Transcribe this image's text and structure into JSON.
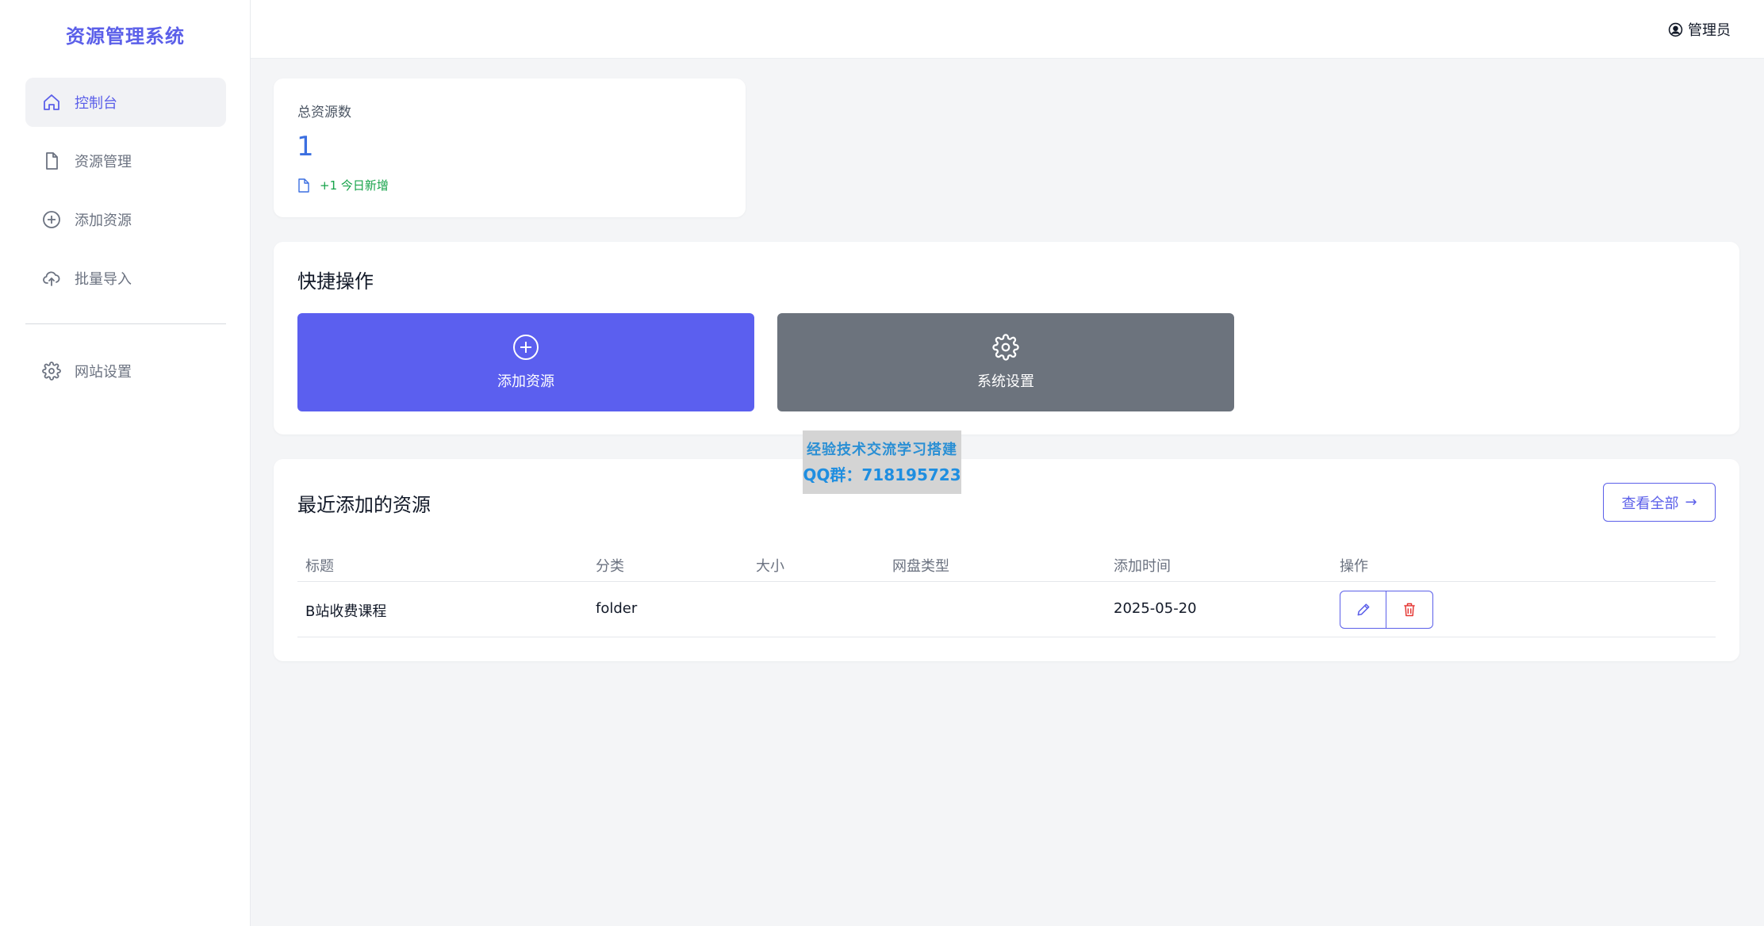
{
  "sidebar": {
    "brand": "资源管理系统",
    "items": [
      {
        "label": "控制台",
        "icon": "home-icon",
        "active": true
      },
      {
        "label": "资源管理",
        "icon": "file-icon"
      },
      {
        "label": "添加资源",
        "icon": "plus-circle-icon"
      },
      {
        "label": "批量导入",
        "icon": "cloud-upload-icon"
      }
    ],
    "settings": {
      "label": "网站设置",
      "icon": "gear-icon"
    }
  },
  "header": {
    "user_label": "管理员",
    "user_icon": "user-circle-icon"
  },
  "stats": {
    "label": "总资源数",
    "value": "1",
    "footnote": "+1 今日新增"
  },
  "quick": {
    "title": "快捷操作",
    "add_label": "添加资源",
    "settings_label": "系统设置"
  },
  "recent": {
    "title": "最近添加的资源",
    "view_all": "查看全部",
    "columns": [
      "标题",
      "分类",
      "大小",
      "网盘类型",
      "添加时间",
      "操作"
    ],
    "rows": [
      {
        "title": "B站收费课程",
        "category": "folder",
        "size": "",
        "disk_type": "",
        "added": "2025-05-20"
      }
    ]
  },
  "watermark": {
    "line1": "经验技术交流学习搭建",
    "line2": "QQ群：718195723"
  },
  "colors": {
    "accent": "#5b5fe9",
    "primary_button": "#5b5fef",
    "secondary_button": "#6c737d",
    "stat_value": "#3b6fe0",
    "positive": "#16a34a",
    "danger": "#e53935"
  }
}
